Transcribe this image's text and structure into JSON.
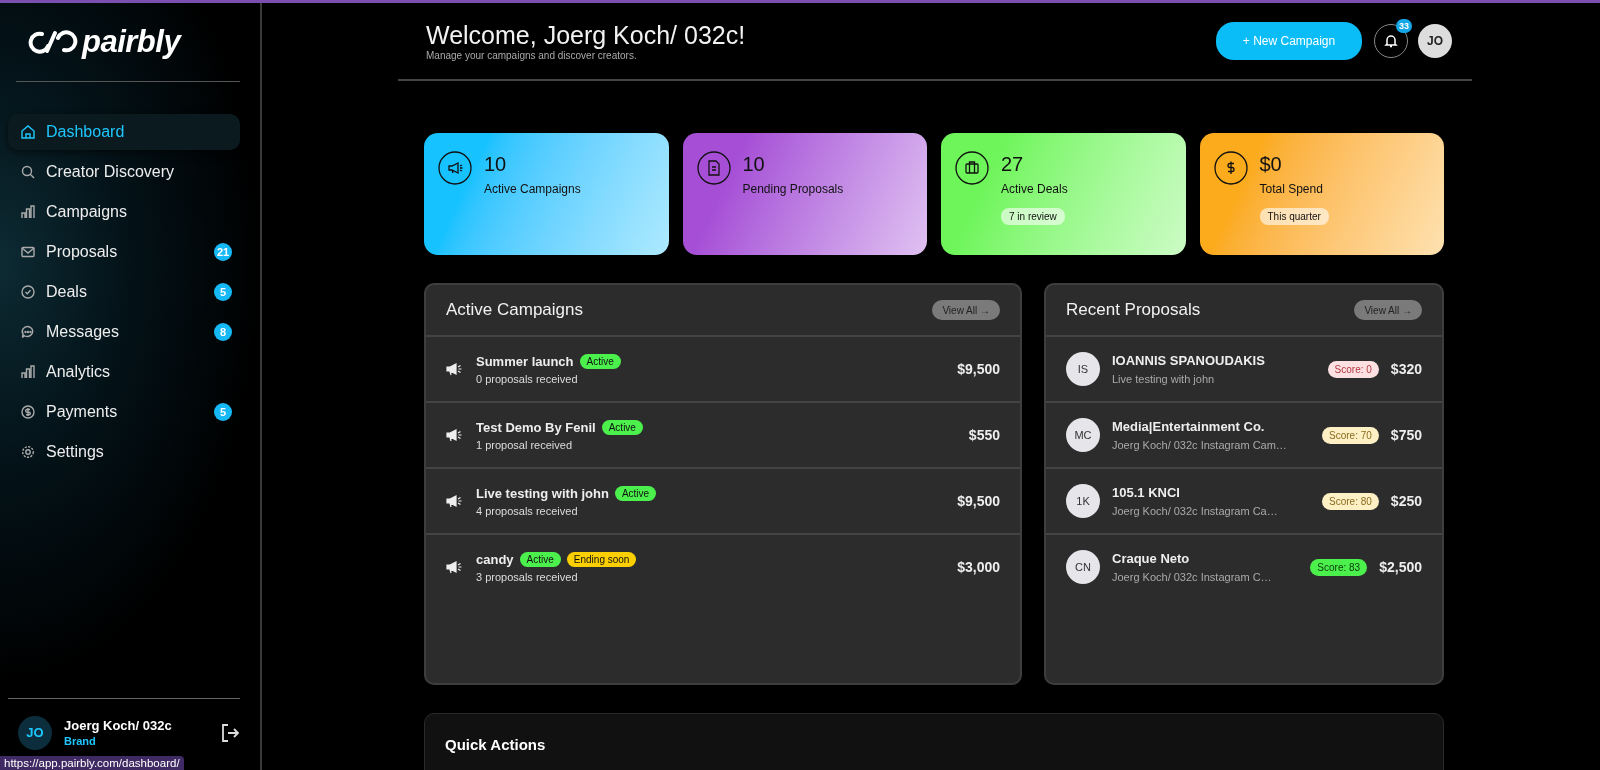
{
  "sidebar": {
    "logo": "pairbly",
    "items": [
      {
        "label": "Dashboard",
        "selected": true
      },
      {
        "label": "Creator Discovery",
        "selected": false
      },
      {
        "label": "Campaigns",
        "selected": false
      },
      {
        "label": "Proposals",
        "selected": false,
        "badge": "21"
      },
      {
        "label": "Deals",
        "selected": false,
        "badge": "5"
      },
      {
        "label": "Messages",
        "selected": false,
        "badge": "8"
      },
      {
        "label": "Analytics",
        "selected": false
      },
      {
        "label": "Payments",
        "selected": false,
        "badge": "5"
      },
      {
        "label": "Settings",
        "selected": false
      }
    ],
    "user": {
      "initials": "JO",
      "name": "Joerg Koch/ 032c",
      "role": "Brand"
    }
  },
  "status_url": "https://app.pairbly.com/dashboard/",
  "header": {
    "title": "Welcome, Joerg Koch/ 032c!",
    "subtitle": "Manage your campaigns and discover creators.",
    "new_button": "+ New Campaign",
    "notifications": "33",
    "avatar": "JO"
  },
  "stats": [
    {
      "value": "10",
      "label": "Active Campaigns",
      "color": "#16c2ff"
    },
    {
      "value": "10",
      "label": "Pending Proposals",
      "color": "#a64fd6"
    },
    {
      "value": "27",
      "label": "Active Deals",
      "color": "#6ef55a",
      "note": "7 in review"
    },
    {
      "value": "$0",
      "label": "Total Spend",
      "color": "#fbab1c",
      "note": "This quarter"
    }
  ],
  "active_campaigns": {
    "title": "Active Campaigns",
    "view_all": "View All →",
    "rows": [
      {
        "name": "Summer launch",
        "tags": [
          {
            "label": "Active",
            "color": "#4cf04c"
          }
        ],
        "proposals": "0 proposals received",
        "amount": "$9,500"
      },
      {
        "name": "Test Demo By Fenil",
        "tags": [
          {
            "label": "Active",
            "color": "#4cf04c"
          }
        ],
        "proposals": "1 proposal received",
        "amount": "$550"
      },
      {
        "name": "Live testing with john",
        "tags": [
          {
            "label": "Active",
            "color": "#4cf04c"
          }
        ],
        "proposals": "4 proposals received",
        "amount": "$9,500"
      },
      {
        "name": "candy",
        "tags": [
          {
            "label": "Active",
            "color": "#4cf04c"
          },
          {
            "label": "Ending soon",
            "color": "#fcd000"
          }
        ],
        "proposals": "3 proposals received",
        "amount": "$3,000"
      }
    ]
  },
  "recent_proposals": {
    "title": "Recent Proposals",
    "view_all": "View All →",
    "rows": [
      {
        "initials": "IS",
        "name": "IOANNIS SPANOUDAKIS",
        "campaign": "Live testing with john",
        "score": "Score: 0",
        "color": "#fde0e2",
        "amount": "$320"
      },
      {
        "initials": "MC",
        "name": "Media|Entertainment Co.",
        "campaign": "Joerg Koch/ 032c Instagram Cam…",
        "score": "Score: 70",
        "color": "#fdf0c4",
        "amount": "$750"
      },
      {
        "initials": "1K",
        "name": "105.1 KNCI",
        "campaign": "Joerg Koch/ 032c Instagram Ca…",
        "score": "Score: 80",
        "color": "#fdf0c4",
        "amount": "$250"
      },
      {
        "initials": "CN",
        "name": "Craque Neto",
        "campaign": "Joerg Koch/ 032c Instagram C…",
        "score": "Score: 83",
        "color": "#4cf04c",
        "amount": "$2,500"
      }
    ]
  },
  "quick_actions": {
    "title": "Quick Actions"
  }
}
